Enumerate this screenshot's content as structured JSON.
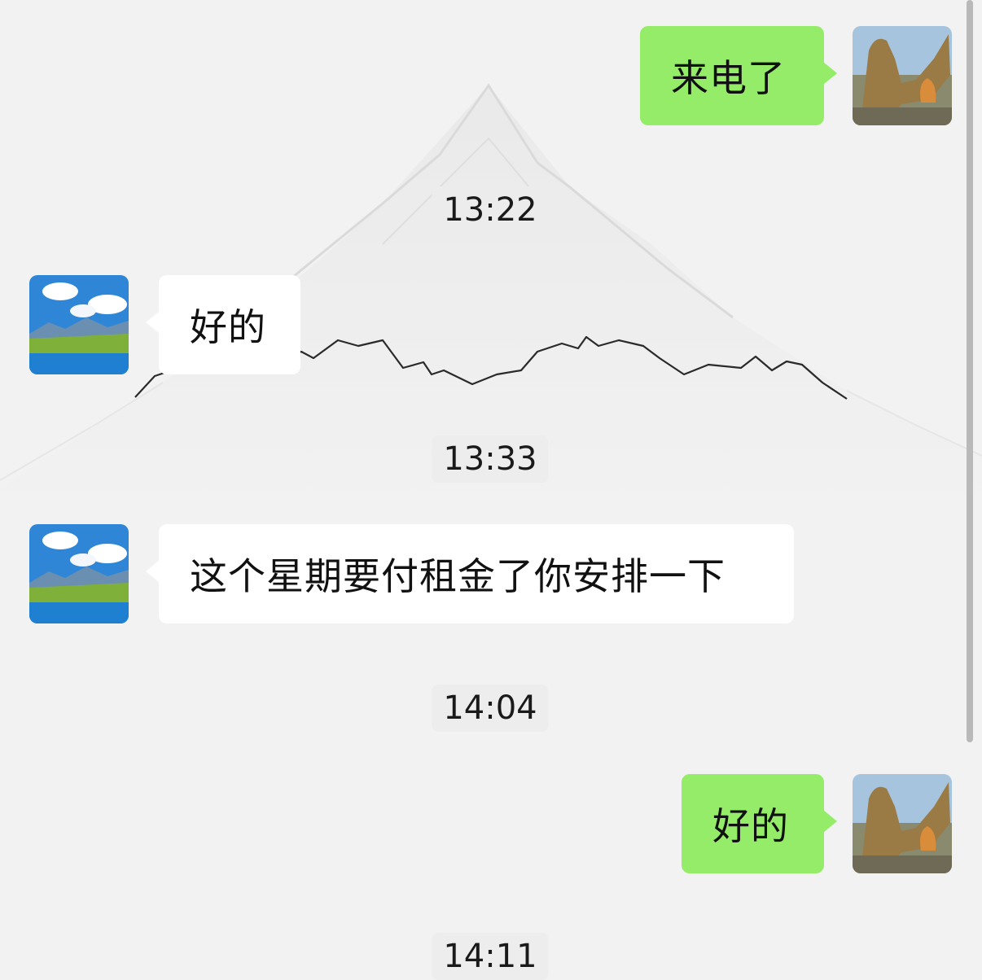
{
  "messages": [
    {
      "side": "right",
      "avatar": "shiba-dinosaur-avatar",
      "text": "来电了"
    },
    {
      "time": "13:22"
    },
    {
      "side": "left",
      "avatar": "lake-landscape-avatar",
      "text": "好的"
    },
    {
      "time": "13:33"
    },
    {
      "side": "left",
      "avatar": "lake-landscape-avatar",
      "text": "这个星期要付租金了你安排一下"
    },
    {
      "time": "14:04"
    },
    {
      "side": "right",
      "avatar": "shiba-dinosaur-avatar",
      "text": "好的"
    },
    {
      "time": "14:11"
    }
  ],
  "colors": {
    "background": "#f2f2f2",
    "sent_bubble": "#95ec69",
    "received_bubble": "#ffffff",
    "timestamp_chip": "#ececec"
  }
}
